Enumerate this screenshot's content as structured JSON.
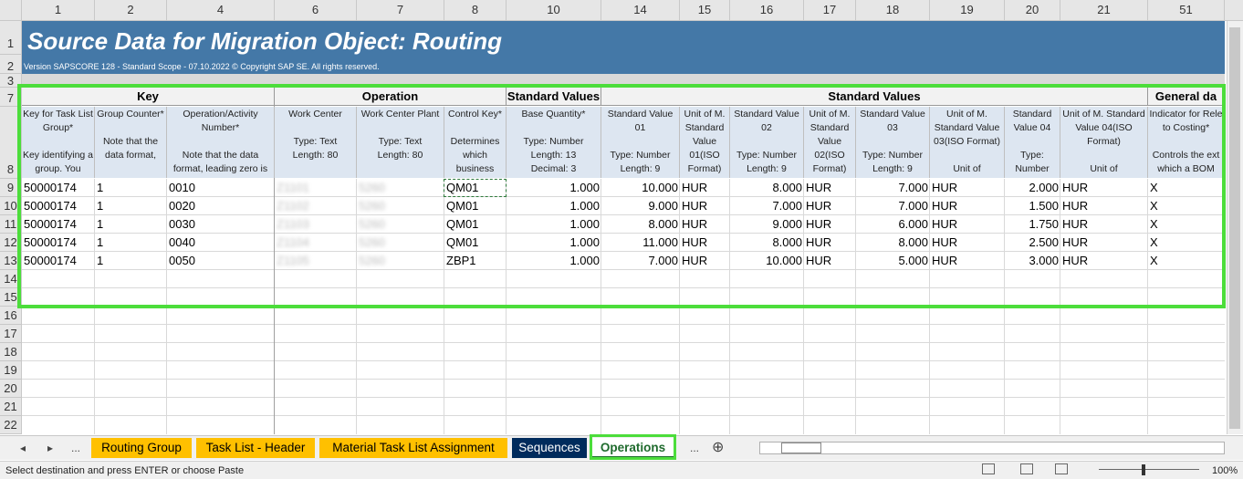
{
  "columns": [
    "1",
    "2",
    "4",
    "6",
    "7",
    "8",
    "10",
    "14",
    "15",
    "16",
    "17",
    "18",
    "19",
    "20",
    "21",
    "51"
  ],
  "rows": [
    "1",
    "2",
    "3",
    "7",
    "8",
    "9",
    "10",
    "11",
    "12",
    "13",
    "14",
    "15",
    "16",
    "17",
    "18",
    "19",
    "20",
    "21",
    "22"
  ],
  "title": "Source Data for Migration Object:  Routing",
  "version": "Version SAPSCORE 128  - Standard Scope - 07.10.2022 © Copyright SAP SE. All rights reserved.",
  "groups": [
    "Key",
    "Operation",
    "Standard Values",
    "Standard Values",
    "General da"
  ],
  "headers": [
    "Key for Task List Group*\n\nKey identifying a group. You",
    "Group Counter*\n\nNote that the data format,",
    "Operation/Activity Number*\n\nNote that the data format, leading zero is",
    "Work Center\n\nType: Text\nLength: 80",
    "Work Center Plant\n\nType: Text\nLength: 80",
    "Control Key*\n\nDetermines which business",
    "Base Quantity*\n\nType: Number\nLength: 13\nDecimal: 3",
    "Standard Value 01\n\nType: Number\nLength: 9",
    "Unit of M. Standard Value 01(ISO Format)",
    "Standard Value 02\n\nType: Number\nLength: 9",
    "Unit of M. Standard Value 02(ISO Format)",
    "Standard Value 03\n\nType: Number\nLength: 9",
    "Unit of M. Standard Value 03(ISO Format)\n\nUnit of",
    "Standard Value 04\n\nType: Number",
    "Unit of M. Standard Value 04(ISO Format)\n\nUnit of",
    "Indicator for Rele to Costing*\n\nControls the ext which a BOM"
  ],
  "data": [
    [
      "50000174",
      "1",
      "0010",
      "Z1101",
      "5260",
      "QM01",
      "1.000",
      "10.000",
      "HUR",
      "8.000",
      "HUR",
      "7.000",
      "HUR",
      "2.000",
      "HUR",
      "X"
    ],
    [
      "50000174",
      "1",
      "0020",
      "Z1102",
      "5260",
      "QM01",
      "1.000",
      "9.000",
      "HUR",
      "7.000",
      "HUR",
      "7.000",
      "HUR",
      "1.500",
      "HUR",
      "X"
    ],
    [
      "50000174",
      "1",
      "0030",
      "Z1103",
      "5260",
      "QM01",
      "1.000",
      "8.000",
      "HUR",
      "9.000",
      "HUR",
      "6.000",
      "HUR",
      "1.750",
      "HUR",
      "X"
    ],
    [
      "50000174",
      "1",
      "0040",
      "Z1104",
      "5260",
      "QM01",
      "1.000",
      "11.000",
      "HUR",
      "8.000",
      "HUR",
      "8.000",
      "HUR",
      "2.500",
      "HUR",
      "X"
    ],
    [
      "50000174",
      "1",
      "0050",
      "Z1105",
      "5260",
      "ZBP1",
      "1.000",
      "7.000",
      "HUR",
      "10.000",
      "HUR",
      "5.000",
      "HUR",
      "3.000",
      "HUR",
      "X"
    ]
  ],
  "tabs": {
    "nav_prev": "◂",
    "nav_next": "▸",
    "more_left": "...",
    "routing_group": "Routing Group",
    "task_list_header": "Task List - Header",
    "material_assignment": "Material Task List Assignment",
    "sequences": "Sequences",
    "operations": "Operations",
    "more_right": "...",
    "add": "⊕"
  },
  "status": {
    "message": "Select destination and press ENTER or choose Paste",
    "zoom": "100%"
  },
  "colors": {
    "title_band": "#4478a7",
    "highlight": "#4cdd3b",
    "tab_yellow": "#ffc000",
    "tab_navy": "#002b5c"
  }
}
